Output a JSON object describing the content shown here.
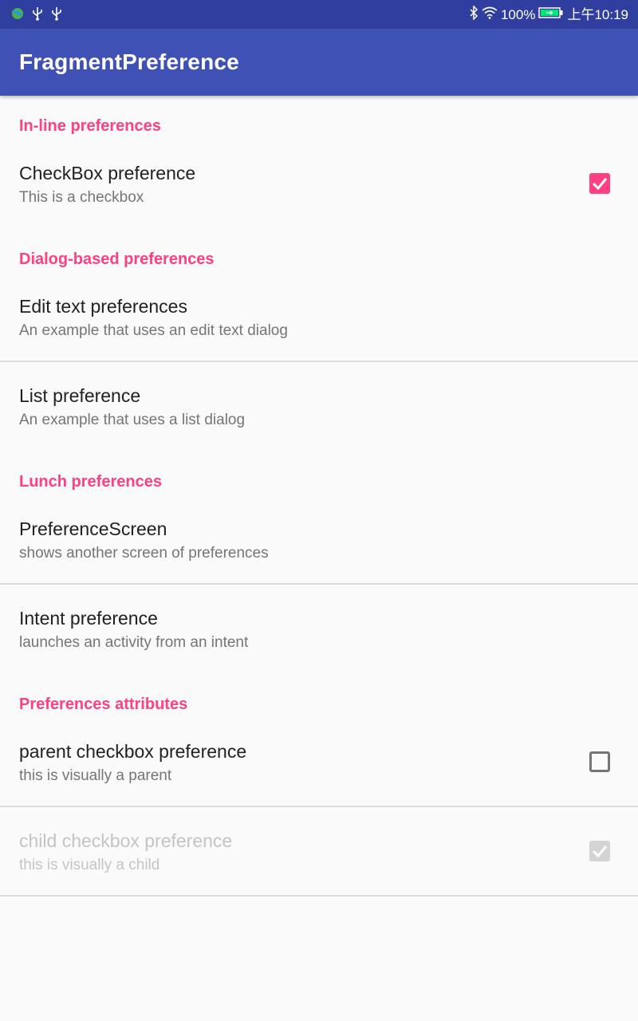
{
  "status_bar": {
    "battery": "100%",
    "time": "上午10:19",
    "icons": [
      "globe-icon",
      "usb-icon",
      "usb-icon",
      "bluetooth-icon",
      "wifi-icon",
      "battery-icon"
    ]
  },
  "app_bar": {
    "title": "FragmentPreference"
  },
  "colors": {
    "primary": "#3f51b5",
    "primary_dark": "#303f9f",
    "accent": "#ff4081"
  },
  "categories": [
    {
      "title": "In-line preferences",
      "items": [
        {
          "title": "CheckBox preference",
          "summary": "This is a checkbox",
          "checked": true,
          "enabled": true
        }
      ]
    },
    {
      "title": "Dialog-based preferences",
      "items": [
        {
          "title": "Edit text preferences",
          "summary": "An example that uses an edit text dialog"
        },
        {
          "title": "List preference",
          "summary": "An example that uses a list dialog"
        }
      ]
    },
    {
      "title": "Lunch preferences",
      "items": [
        {
          "title": "PreferenceScreen",
          "summary": "shows another screen of preferences"
        },
        {
          "title": "Intent preference",
          "summary": "launches an activity from an intent"
        }
      ]
    },
    {
      "title": "Preferences attributes",
      "items": [
        {
          "title": "parent checkbox preference",
          "summary": "this is visually a parent",
          "checked": false,
          "enabled": true
        },
        {
          "title": "child checkbox preference",
          "summary": "this is visually a child",
          "checked": true,
          "enabled": false
        }
      ]
    }
  ]
}
